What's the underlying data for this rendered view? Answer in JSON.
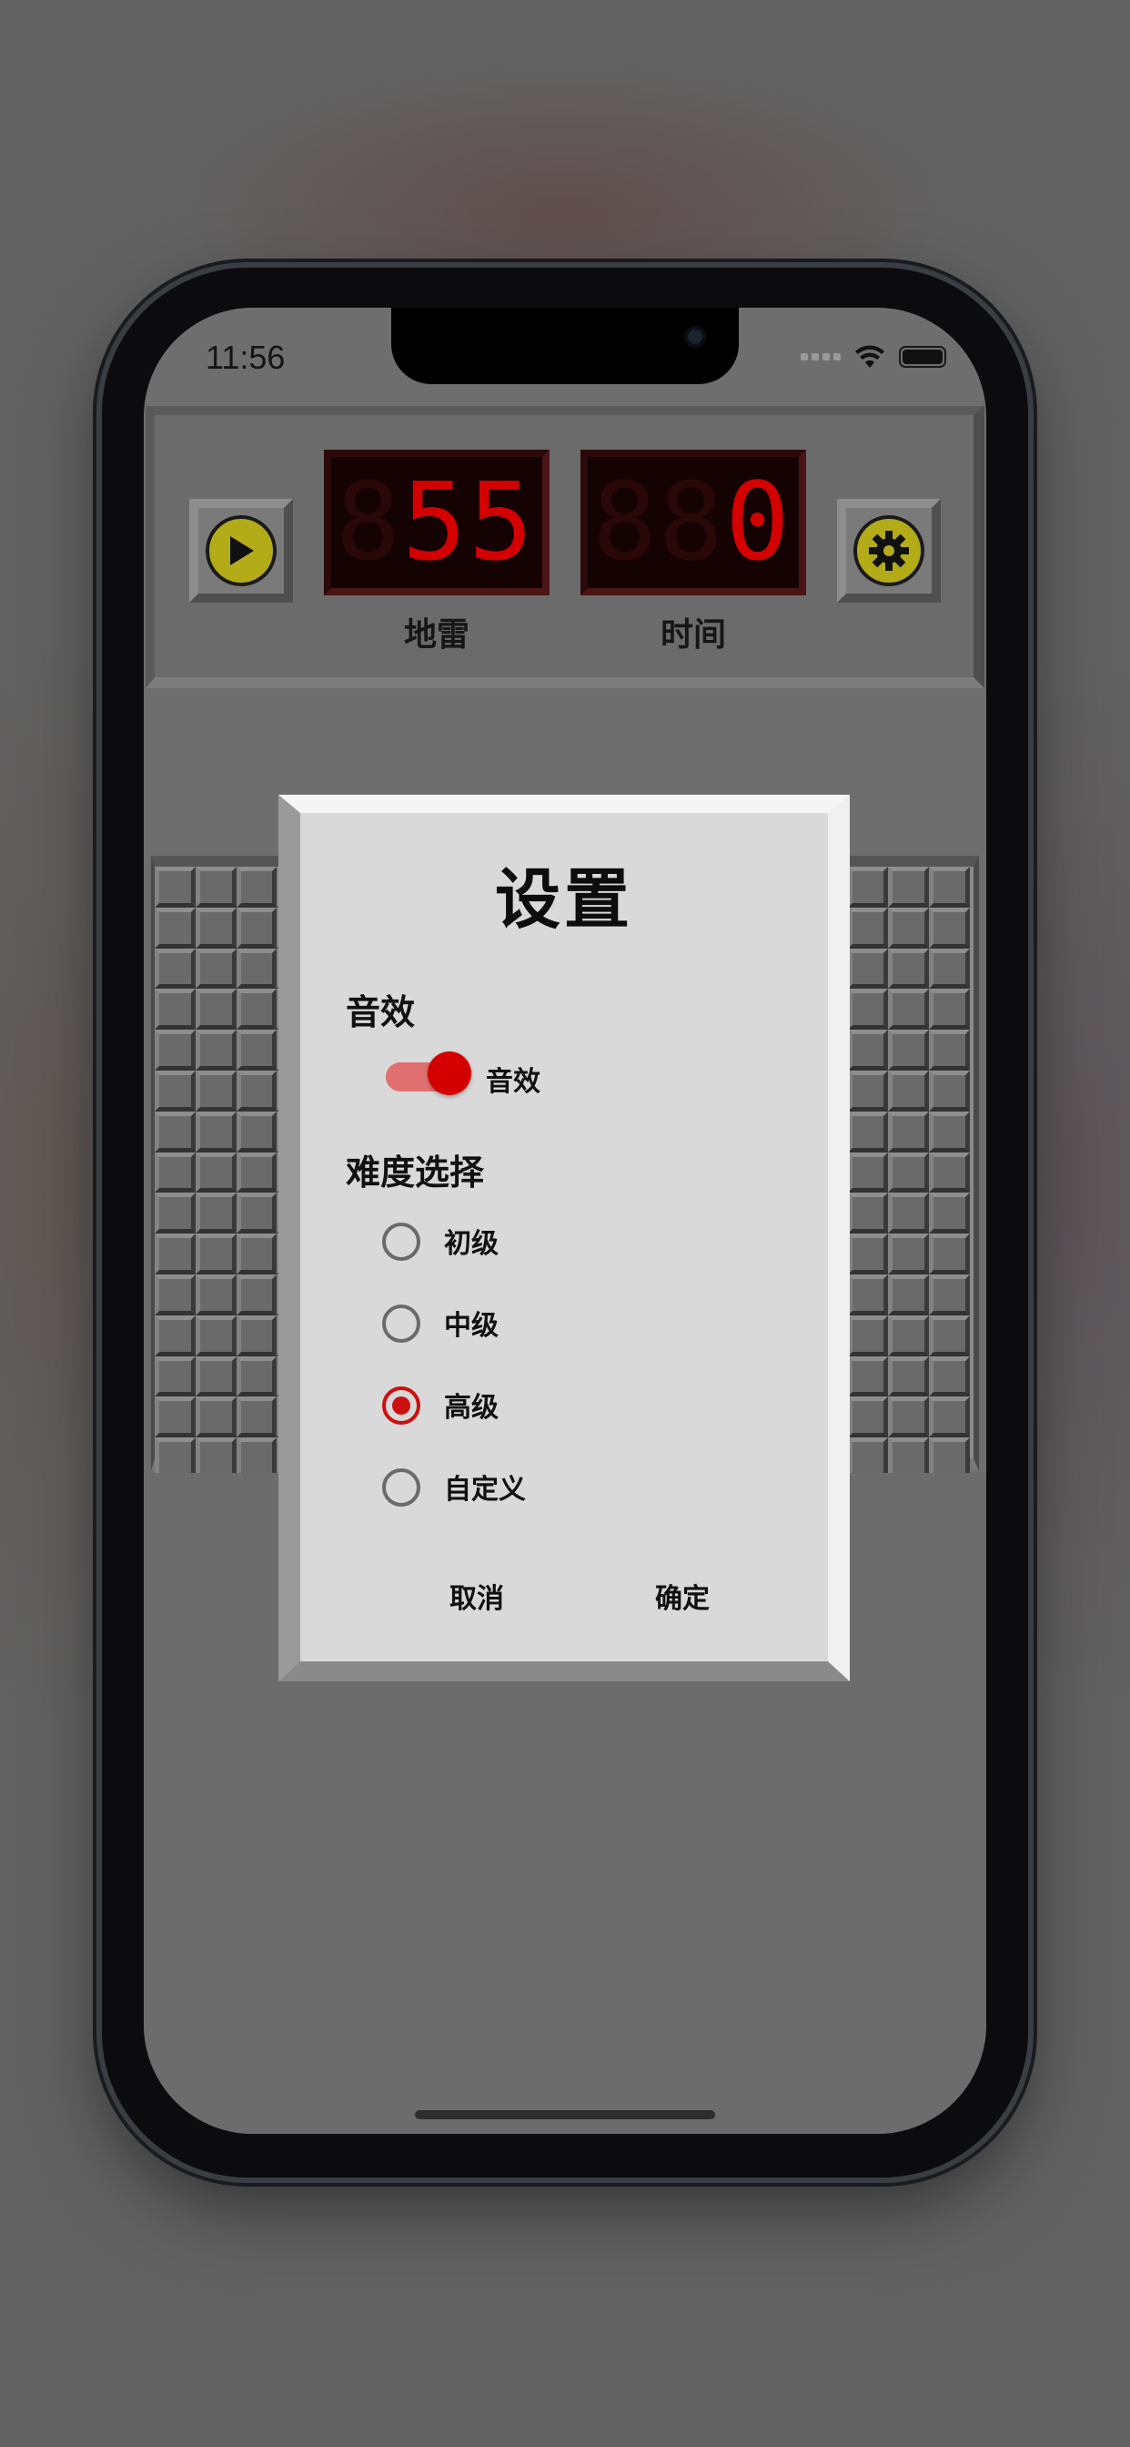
{
  "status_bar": {
    "time": "11:56"
  },
  "header": {
    "mines_display": "55",
    "mines_label": "地雷",
    "time_display": "0",
    "time_label": "时间",
    "icons": {
      "play": "play-icon",
      "settings": "gear-icon"
    }
  },
  "dialog": {
    "title": "设置",
    "sound_section": "音效",
    "sound_toggle_label": "音效",
    "sound_enabled": true,
    "difficulty_section": "难度选择",
    "options": [
      "初级",
      "中级",
      "高级",
      "自定义"
    ],
    "selected_option": "高级",
    "cancel_label": "取消",
    "confirm_label": "确定"
  },
  "colors": {
    "accent": "#d40000",
    "lcd_bg": "#150303",
    "icon_yellow": "#b3ac18"
  }
}
